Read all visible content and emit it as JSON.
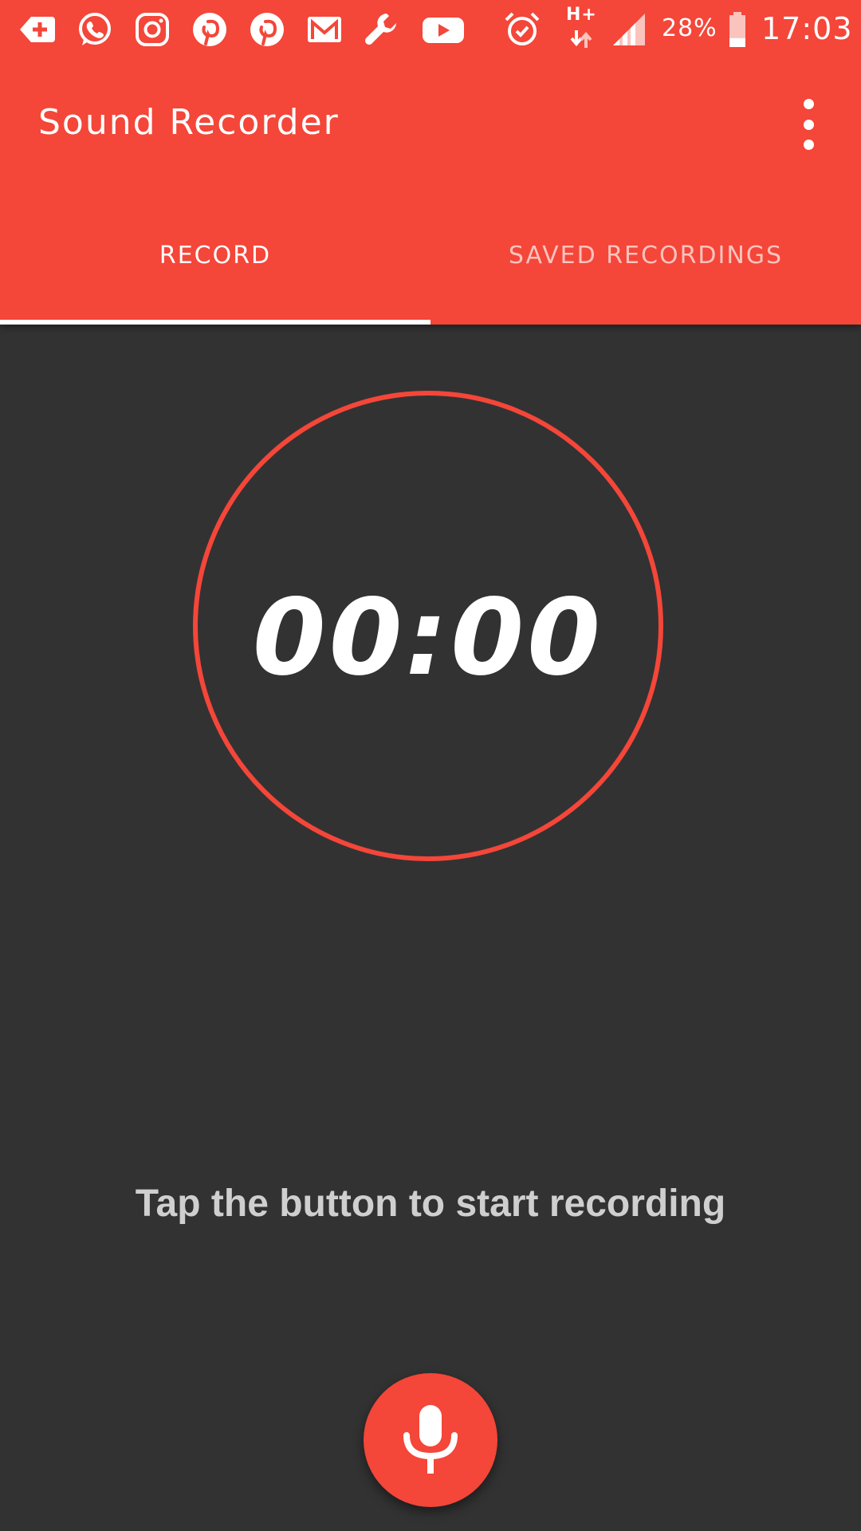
{
  "status_bar": {
    "icons": [
      "message-plus-icon",
      "whatsapp-icon",
      "instagram-icon",
      "pinterest-icon",
      "pinterest-icon",
      "gmail-icon",
      "wrench-icon",
      "youtube-icon",
      "alarm-icon"
    ],
    "network": "H+",
    "battery_percent": "28%",
    "battery_level": 0.28,
    "time": "17:03"
  },
  "toolbar": {
    "title": "Sound Recorder",
    "menu_icon": "more-vert-icon"
  },
  "tabs": [
    {
      "label": "RECORD",
      "selected": true
    },
    {
      "label": "SAVED RECORDINGS",
      "selected": false
    }
  ],
  "timer": {
    "value": "00:00"
  },
  "hint": "Tap the button to start recording",
  "record_button": {
    "icon": "microphone-icon"
  },
  "colors": {
    "primary": "#F44639",
    "background": "#323232",
    "tab_inactive": "#FBC3BD",
    "hint_text": "#CFCFCF"
  }
}
